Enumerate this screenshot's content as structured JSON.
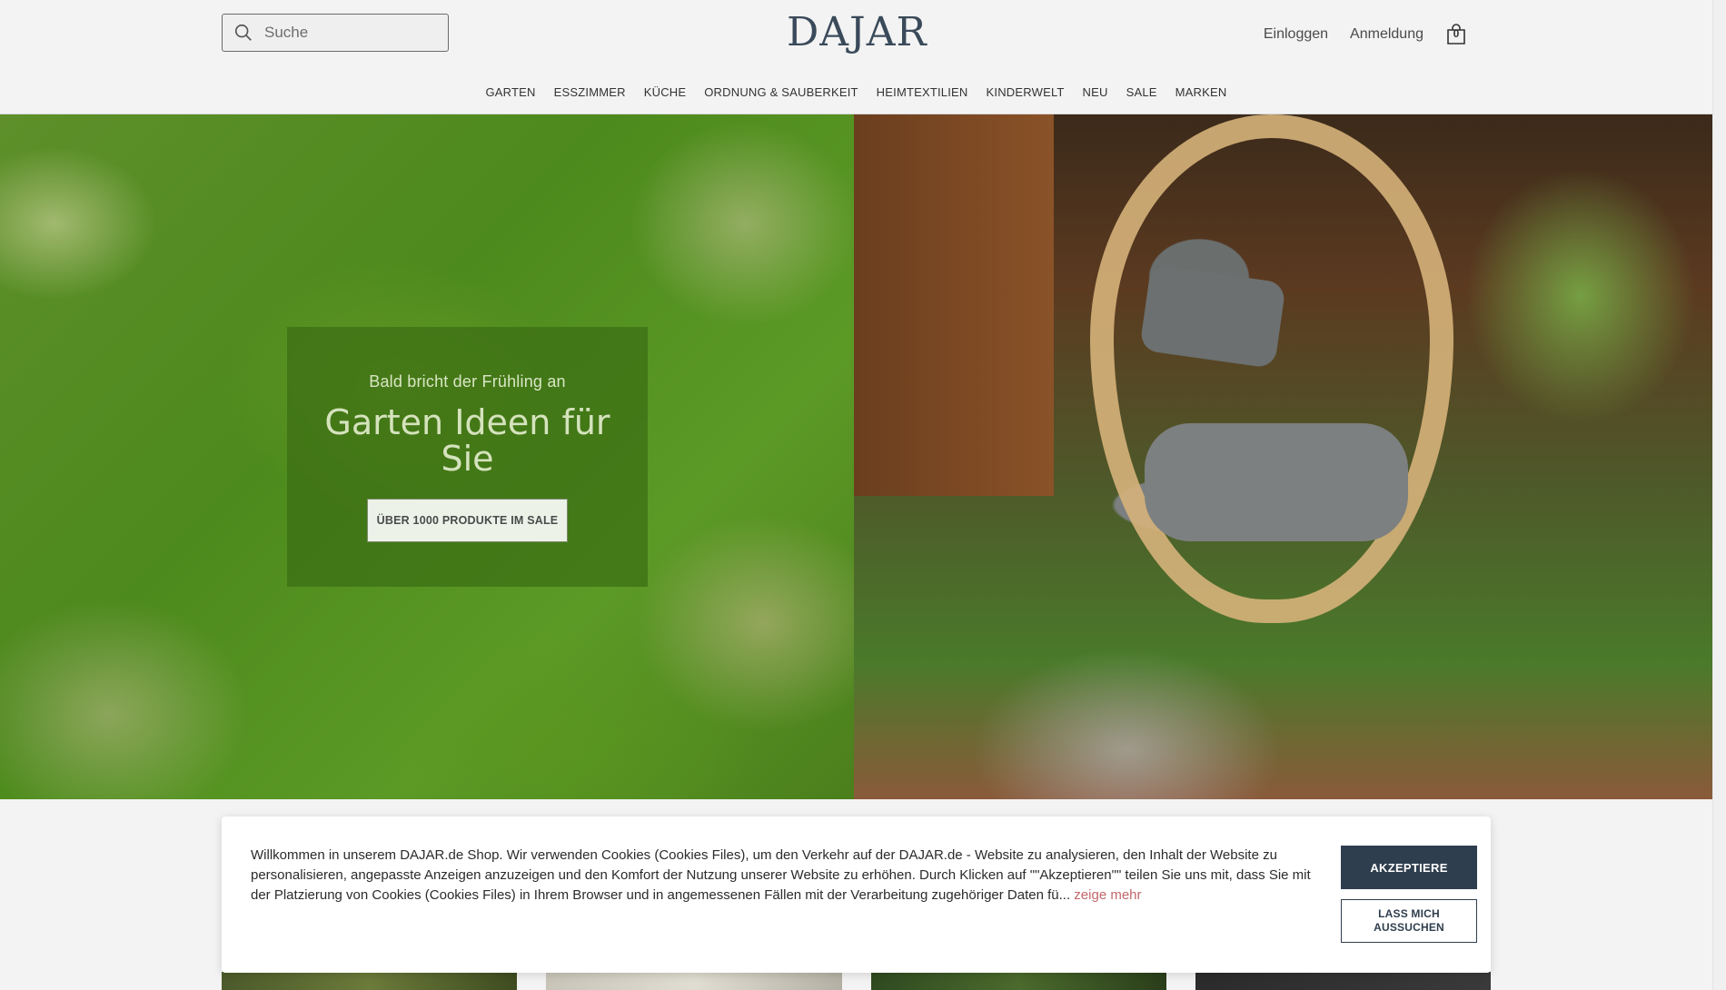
{
  "header": {
    "search_placeholder": "Suche",
    "logo": "DAJAR",
    "login_label": "Einloggen",
    "register_label": "Anmeldung",
    "cart_count": "0"
  },
  "nav": {
    "items": [
      "GARTEN",
      "ESSZIMMER",
      "KÜCHE",
      "ORDNUNG & SAUBERKEIT",
      "HEIMTEXTILIEN",
      "KINDERWELT",
      "NEU",
      "SALE",
      "MARKEN"
    ]
  },
  "hero": {
    "kicker": "Bald bricht der Frühling an",
    "title": "Garten Ideen für Sie",
    "button_label": "ÜBER 1000 PRODUKTE IM SALE"
  },
  "cookie": {
    "text": "Willkommen in unserem DAJAR.de Shop. Wir verwenden Cookies (Cookies Files), um den Verkehr auf der DAJAR.de - Website zu analysieren, den Inhalt der Website zu personalisieren, angepasste Anzeigen anzuzeigen und den Komfort der Nutzung unserer Website zu erhöhen. Durch Klicken auf \"\"Akzeptieren\"\" teilen Sie uns mit, dass Sie mit der Platzierung von Cookies (Cookies Files) in Ihrem Browser und in angemessenen Fällen mit der Verarbeitung zugehöriger Daten fü...",
    "more_label": "zeige mehr",
    "accept_label": "AKZEPTIERE",
    "choose_label": "LASS MICH AUSSUCHEN"
  },
  "colors": {
    "accent_dark": "#2f3e4e",
    "link_pink": "#c2666a",
    "hero_green": "#4d8a1d"
  }
}
